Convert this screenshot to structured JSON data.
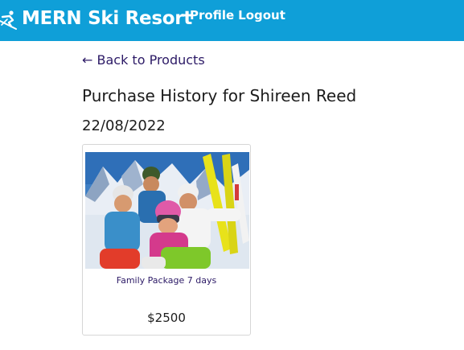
{
  "header": {
    "brand": "MERN Ski Resort",
    "nav": {
      "profile": "Profile",
      "logout": "Logout"
    },
    "logo_icon": "skier-icon",
    "background_color": "#0f9fd8"
  },
  "main": {
    "back_link": "← Back to Products",
    "title": "Purchase History for Shireen Reed",
    "date": "22/08/2022",
    "purchases": [
      {
        "name": "Family Package 7 days",
        "price": "$2500",
        "image": "family-skiing-photo"
      }
    ]
  }
}
